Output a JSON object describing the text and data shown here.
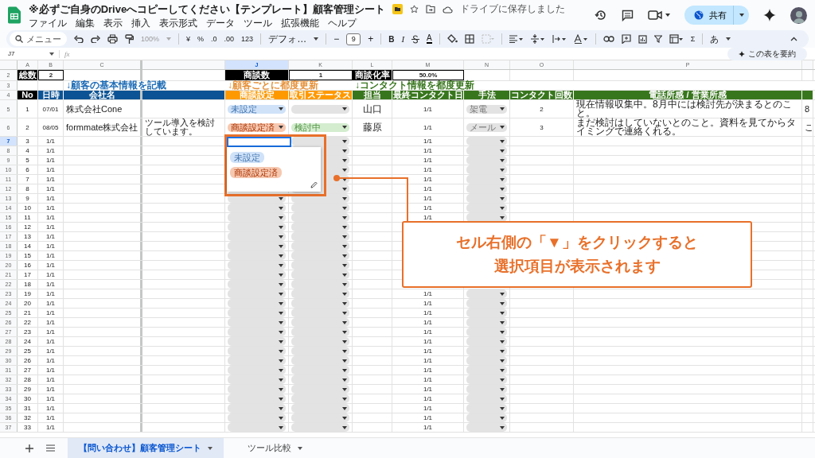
{
  "title": "※必ずご自身のDriveへコピーしてください【テンプレート】顧客管理シート",
  "save_status": "ドライブに保存しました",
  "share": "共有",
  "menu": [
    "ファイル",
    "編集",
    "表示",
    "挿入",
    "表示形式",
    "データ",
    "ツール",
    "拡張機能",
    "ヘルプ"
  ],
  "toolbar": {
    "search": "メニュー",
    "zoom": "100%",
    "currency": "¥",
    "percent": "%",
    "decrease_decimal": ".0",
    "increase_decimal": ".00",
    "format": "123",
    "font": "デフォ…",
    "minus": "−",
    "font_size": "9",
    "plus": "+",
    "bold": "B",
    "italic": "I",
    "text_color": "A",
    "sum": "Σ",
    "input_tools": "あ"
  },
  "formula_bar": {
    "name_box": "J7",
    "fx": "fx",
    "summarize": "この表を要約"
  },
  "sheet": {
    "columns": [
      {
        "letter": "A",
        "selected": false
      },
      {
        "letter": "B",
        "selected": false
      },
      {
        "letter": "C",
        "selected": false
      },
      {
        "selected": false
      },
      {
        "letter": "J",
        "selected": true
      },
      {
        "letter": "K",
        "selected": false
      },
      {
        "letter": "L",
        "selected": false
      },
      {
        "letter": "M",
        "selected": false
      },
      {
        "letter": "N",
        "selected": false
      },
      {
        "letter": "O",
        "selected": false
      },
      {
        "letter": "P",
        "selected": false
      },
      {
        "selected": false
      }
    ],
    "rows": [
      {
        "kind": "summary",
        "row": "2",
        "selected": false,
        "cells": [
          {
            "kind": "label",
            "text": "総数"
          },
          {
            "kind": "value",
            "text": "2"
          },
          null,
          null,
          {
            "kind": "label",
            "text": "商談数"
          },
          {
            "kind": "value",
            "text": "1"
          },
          {
            "kind": "label",
            "text": "商談化率"
          },
          {
            "kind": "value",
            "text": "50.0%"
          },
          null,
          null,
          null,
          null
        ]
      },
      {
        "kind": "notes",
        "row": "3",
        "selected": false,
        "cells": [
          null,
          null,
          {
            "text": "↓顧客の基本情報を記載",
            "color": "#1c6bb5"
          },
          null,
          {
            "text": "↓顧客ごとに都度更新",
            "color": "#e69138"
          },
          null,
          {
            "text": "↓コンタクト情報を都度更新",
            "color": "#38761d"
          },
          null,
          null,
          null,
          null,
          null
        ]
      },
      {
        "kind": "header",
        "row": "4",
        "selected": false,
        "cells": [
          {
            "text": "No",
            "color": "#000000"
          },
          {
            "text": "日時",
            "color": "#0b5394"
          },
          {
            "text": "会社名",
            "color": "#0b5394"
          },
          {
            "color": "#0b5394"
          },
          {
            "text": "商談設定",
            "color": "#ff9900"
          },
          {
            "text": "取引ステータス",
            "color": "#ff9900"
          },
          {
            "text": "担当",
            "color": "#38761d"
          },
          {
            "text": "最終コンタクト日",
            "color": "#38761d"
          },
          {
            "text": "手法",
            "color": "#38761d"
          },
          {
            "text": "コンタクト回数",
            "color": "#38761d"
          },
          {
            "text": "電話所感 / 営業所感",
            "color": "#38761d"
          },
          {
            "color": "#38761d"
          }
        ]
      },
      {
        "kind": "data",
        "row": "5",
        "selected": false,
        "cells": [
          "1",
          "07/01",
          "株式会社Cone",
          null,
          {
            "text": "未設定",
            "color": "#cfe2f8"
          },
          {
            "color": "#e3e3e3"
          },
          "山口",
          "1/1",
          {
            "text": "架電",
            "color": "#e3e3e3"
          },
          "2",
          "現在情報収集中。8月中には検討先が決まるとのこと。",
          "8"
        ]
      },
      {
        "kind": "data",
        "row": "6",
        "selected": false,
        "cells": [
          "2",
          "08/05",
          "formmate株式会社",
          "ツール導入を検討しています。",
          {
            "text": "商談設定済",
            "color": "#f6c8b0"
          },
          {
            "text": "検討中",
            "color": "#d4edcf"
          },
          "藤原",
          "1/1",
          {
            "text": "メール",
            "color": "#e3e3e3"
          },
          "3",
          "まだ検討はしていないとのこと。資料を見てからタイミングで連絡くれる。",
          "こ"
        ]
      },
      {
        "kind": "data",
        "row": "7",
        "selected": true,
        "cells": [
          "3",
          "1/1",
          null,
          null,
          null,
          {
            "color": "#e3e3e3"
          },
          null,
          "1/1",
          {
            "color": "#e3e3e3"
          },
          null,
          null,
          null
        ]
      },
      {
        "kind": "data",
        "row": "8",
        "selected": false,
        "cells": [
          "4",
          "1/1",
          null,
          null,
          null,
          {
            "color": "#e3e3e3"
          },
          null,
          "1/1",
          {
            "color": "#e3e3e3"
          },
          null,
          null,
          null
        ]
      },
      {
        "kind": "data",
        "row": "9",
        "selected": false,
        "cells": [
          "5",
          "1/1",
          null,
          null,
          null,
          {
            "color": "#e3e3e3"
          },
          null,
          "1/1",
          {
            "color": "#e3e3e3"
          },
          null,
          null,
          null
        ]
      },
      {
        "kind": "data",
        "row": "10",
        "selected": false,
        "cells": [
          "6",
          "1/1",
          null,
          null,
          null,
          {
            "color": "#e3e3e3"
          },
          null,
          "1/1",
          {
            "color": "#e3e3e3"
          },
          null,
          null,
          null
        ]
      },
      {
        "kind": "data",
        "row": "11",
        "selected": false,
        "cells": [
          "7",
          "1/1",
          null,
          null,
          null,
          {
            "color": "#e3e3e3"
          },
          null,
          "1/1",
          {
            "color": "#e3e3e3"
          },
          null,
          null,
          null
        ]
      },
      {
        "kind": "data",
        "row": "12",
        "selected": false,
        "cells": [
          "8",
          "1/1",
          null,
          null,
          null,
          {
            "color": "#e3e3e3"
          },
          null,
          "1/1",
          {
            "color": "#e3e3e3"
          },
          null,
          null,
          null
        ]
      },
      {
        "kind": "data",
        "row": "13",
        "selected": false,
        "cells": [
          "9",
          "1/1",
          null,
          null,
          {
            "color": "#e3e3e3"
          },
          {
            "color": "#e3e3e3"
          },
          null,
          "1/1",
          {
            "color": "#e3e3e3"
          },
          null,
          null,
          null
        ]
      },
      {
        "kind": "data",
        "row": "14",
        "selected": false,
        "cells": [
          "10",
          "1/1",
          null,
          null,
          {
            "color": "#e3e3e3"
          },
          {
            "color": "#e3e3e3"
          },
          null,
          "1/1",
          {
            "color": "#e3e3e3"
          },
          null,
          null,
          null
        ]
      },
      {
        "kind": "data",
        "row": "15",
        "selected": false,
        "cells": [
          "11",
          "1/1",
          null,
          null,
          {
            "color": "#e3e3e3"
          },
          {
            "color": "#e3e3e3"
          },
          null,
          "1/1",
          {
            "color": "#e3e3e3"
          },
          null,
          null,
          null
        ]
      },
      {
        "kind": "data",
        "row": "16",
        "selected": false,
        "cells": [
          "12",
          "1/1",
          null,
          null,
          {
            "color": "#e3e3e3"
          },
          {
            "color": "#e3e3e3"
          },
          null,
          null,
          null,
          null,
          null,
          null
        ]
      },
      {
        "kind": "data",
        "row": "17",
        "selected": false,
        "cells": [
          "13",
          "1/1",
          null,
          null,
          {
            "color": "#e3e3e3"
          },
          {
            "color": "#e3e3e3"
          },
          null,
          null,
          null,
          null,
          null,
          null
        ]
      },
      {
        "kind": "data",
        "row": "18",
        "selected": false,
        "cells": [
          "14",
          "1/1",
          null,
          null,
          {
            "color": "#e3e3e3"
          },
          {
            "color": "#e3e3e3"
          },
          null,
          null,
          null,
          null,
          null,
          null
        ]
      },
      {
        "kind": "data",
        "row": "19",
        "selected": false,
        "cells": [
          "15",
          "1/1",
          null,
          null,
          {
            "color": "#e3e3e3"
          },
          {
            "color": "#e3e3e3"
          },
          null,
          null,
          null,
          null,
          null,
          null
        ]
      },
      {
        "kind": "data",
        "row": "20",
        "selected": false,
        "cells": [
          "16",
          "1/1",
          null,
          null,
          {
            "color": "#e3e3e3"
          },
          {
            "color": "#e3e3e3"
          },
          null,
          null,
          null,
          null,
          null,
          null
        ]
      },
      {
        "kind": "data",
        "row": "21",
        "selected": false,
        "cells": [
          "17",
          "1/1",
          null,
          null,
          {
            "color": "#e3e3e3"
          },
          {
            "color": "#e3e3e3"
          },
          null,
          null,
          null,
          null,
          null,
          null
        ]
      },
      {
        "kind": "data",
        "row": "22",
        "selected": false,
        "cells": [
          "18",
          "1/1",
          null,
          null,
          {
            "color": "#e3e3e3"
          },
          {
            "color": "#e3e3e3"
          },
          null,
          null,
          null,
          null,
          null,
          null
        ]
      },
      {
        "kind": "data",
        "row": "23",
        "selected": false,
        "cells": [
          "19",
          "1/1",
          null,
          null,
          {
            "color": "#e3e3e3"
          },
          {
            "color": "#e3e3e3"
          },
          null,
          "1/1",
          {
            "color": "#e3e3e3"
          },
          null,
          null,
          null
        ]
      },
      {
        "kind": "data",
        "row": "24",
        "selected": false,
        "cells": [
          "20",
          "1/1",
          null,
          null,
          {
            "color": "#e3e3e3"
          },
          {
            "color": "#e3e3e3"
          },
          null,
          "1/1",
          {
            "color": "#e3e3e3"
          },
          null,
          null,
          null
        ]
      },
      {
        "kind": "data",
        "row": "25",
        "selected": false,
        "cells": [
          "21",
          "1/1",
          null,
          null,
          {
            "color": "#e3e3e3"
          },
          {
            "color": "#e3e3e3"
          },
          null,
          "1/1",
          {
            "color": "#e3e3e3"
          },
          null,
          null,
          null
        ]
      },
      {
        "kind": "data",
        "row": "26",
        "selected": false,
        "cells": [
          "22",
          "1/1",
          null,
          null,
          {
            "color": "#e3e3e3"
          },
          {
            "color": "#e3e3e3"
          },
          null,
          "1/1",
          {
            "color": "#e3e3e3"
          },
          null,
          null,
          null
        ]
      },
      {
        "kind": "data",
        "row": "27",
        "selected": false,
        "cells": [
          "23",
          "1/1",
          null,
          null,
          {
            "color": "#e3e3e3"
          },
          {
            "color": "#e3e3e3"
          },
          null,
          "1/1",
          {
            "color": "#e3e3e3"
          },
          null,
          null,
          null
        ]
      },
      {
        "kind": "data",
        "row": "28",
        "selected": false,
        "cells": [
          "24",
          "1/1",
          null,
          null,
          {
            "color": "#e3e3e3"
          },
          {
            "color": "#e3e3e3"
          },
          null,
          "1/1",
          {
            "color": "#e3e3e3"
          },
          null,
          null,
          null
        ]
      },
      {
        "kind": "data",
        "row": "29",
        "selected": false,
        "cells": [
          "25",
          "1/1",
          null,
          null,
          {
            "color": "#e3e3e3"
          },
          {
            "color": "#e3e3e3"
          },
          null,
          "1/1",
          {
            "color": "#e3e3e3"
          },
          null,
          null,
          null
        ]
      },
      {
        "kind": "data",
        "row": "30",
        "selected": false,
        "cells": [
          "26",
          "1/1",
          null,
          null,
          {
            "color": "#e3e3e3"
          },
          {
            "color": "#e3e3e3"
          },
          null,
          "1/1",
          {
            "color": "#e3e3e3"
          },
          null,
          null,
          null
        ]
      },
      {
        "kind": "data",
        "row": "31",
        "selected": false,
        "cells": [
          "27",
          "1/1",
          null,
          null,
          {
            "color": "#e3e3e3"
          },
          {
            "color": "#e3e3e3"
          },
          null,
          "1/1",
          {
            "color": "#e3e3e3"
          },
          null,
          null,
          null
        ]
      },
      {
        "kind": "data",
        "row": "32",
        "selected": false,
        "cells": [
          "28",
          "1/1",
          null,
          null,
          {
            "color": "#e3e3e3"
          },
          {
            "color": "#e3e3e3"
          },
          null,
          "1/1",
          {
            "color": "#e3e3e3"
          },
          null,
          null,
          null
        ]
      },
      {
        "kind": "data",
        "row": "33",
        "selected": false,
        "cells": [
          "29",
          "1/1",
          null,
          null,
          {
            "color": "#e3e3e3"
          },
          {
            "color": "#e3e3e3"
          },
          null,
          "1/1",
          {
            "color": "#e3e3e3"
          },
          null,
          null,
          null
        ]
      },
      {
        "kind": "data",
        "row": "34",
        "selected": false,
        "cells": [
          "30",
          "1/1",
          null,
          null,
          {
            "color": "#e3e3e3"
          },
          {
            "color": "#e3e3e3"
          },
          null,
          "1/1",
          {
            "color": "#e3e3e3"
          },
          null,
          null,
          null
        ]
      },
      {
        "kind": "data",
        "row": "35",
        "selected": false,
        "cells": [
          "31",
          "1/1",
          null,
          null,
          {
            "color": "#e3e3e3"
          },
          {
            "color": "#e3e3e3"
          },
          null,
          "1/1",
          {
            "color": "#e3e3e3"
          },
          null,
          null,
          null
        ]
      },
      {
        "kind": "data",
        "row": "36",
        "selected": false,
        "cells": [
          "32",
          "1/1",
          null,
          null,
          {
            "color": "#e3e3e3"
          },
          {
            "color": "#e3e3e3"
          },
          null,
          "1/1",
          {
            "color": "#e3e3e3"
          },
          null,
          null,
          null
        ]
      },
      {
        "kind": "data",
        "row": "37",
        "selected": false,
        "cells": [
          "33",
          "1/1",
          null,
          null,
          {
            "color": "#e3e3e3"
          },
          {
            "color": "#e3e3e3"
          },
          null,
          "1/1",
          {
            "color": "#e3e3e3"
          },
          null,
          null,
          null
        ]
      }
    ]
  },
  "dropdown": {
    "options": [
      {
        "text": "未設定",
        "color": "#cfe2f8"
      },
      {
        "text": "商談設定済",
        "color": "#f6c8b0"
      }
    ]
  },
  "callout": {
    "lines": [
      "セル右側の「▼」をクリックすると",
      "選択項目が表示されます"
    ]
  },
  "sheet_tabs": [
    {
      "label": "【問い合わせ】顧客管理シート",
      "selected": true
    },
    {
      "label": "ツール比較",
      "selected": false
    }
  ]
}
